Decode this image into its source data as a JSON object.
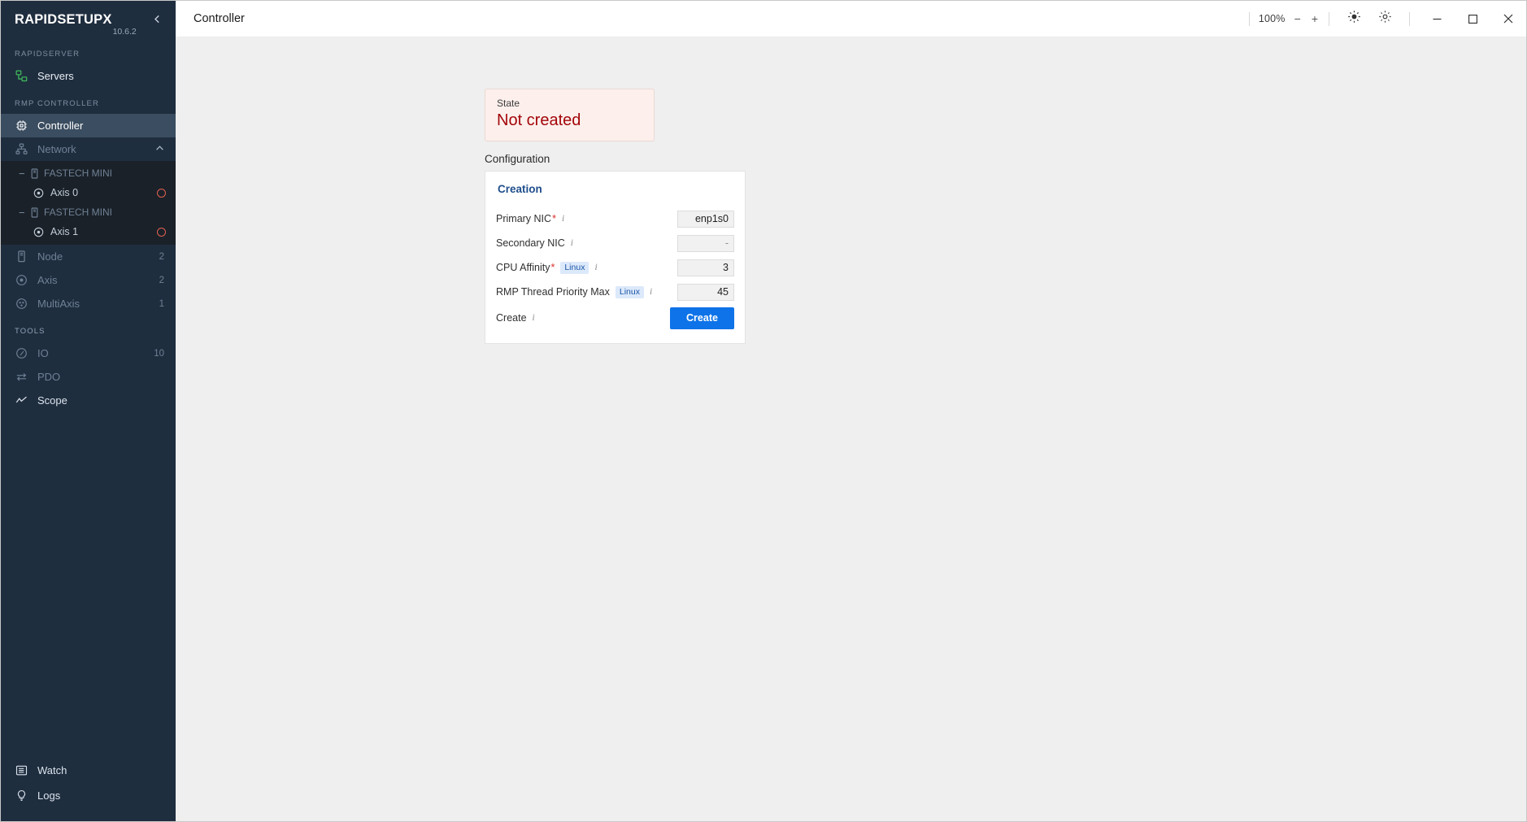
{
  "sidebar": {
    "brand": {
      "name": "RAPIDSETUPX",
      "version": "10.6.2",
      "collapse_icon": "chevron-left-icon"
    },
    "sections": [
      {
        "label": "RAPIDSERVER"
      },
      {
        "label": "RMP CONTROLLER"
      },
      {
        "label": "TOOLS"
      }
    ],
    "servers_item": {
      "label": "Servers",
      "icon": "servers-icon"
    },
    "controller_item": {
      "label": "Controller",
      "icon": "chip-icon"
    },
    "network_item": {
      "label": "Network",
      "icon": "network-icon",
      "chevron": "chevron-up-icon"
    },
    "tree": [
      {
        "label": "FASTECH MINI",
        "icon": "device-icon",
        "expander": "minus-icon"
      },
      {
        "label": "Axis 0",
        "icon": "axis-icon",
        "status": "status-ring-red"
      },
      {
        "label": "FASTECH MINI",
        "icon": "device-icon",
        "expander": "minus-icon"
      },
      {
        "label": "Axis 1",
        "icon": "axis-icon",
        "status": "status-ring-red"
      }
    ],
    "resource_items": [
      {
        "label": "Node",
        "icon": "node-icon",
        "badge": "2"
      },
      {
        "label": "Axis",
        "icon": "axis-icon",
        "badge": "2"
      },
      {
        "label": "MultiAxis",
        "icon": "multiaxis-icon",
        "badge": "1"
      }
    ],
    "tools_items": [
      {
        "label": "IO",
        "icon": "io-icon",
        "badge": "10"
      },
      {
        "label": "PDO",
        "icon": "pdo-icon",
        "badge": ""
      },
      {
        "label": "Scope",
        "icon": "scope-icon",
        "badge": ""
      }
    ],
    "bottom_items": [
      {
        "label": "Watch",
        "icon": "watch-icon"
      },
      {
        "label": "Logs",
        "icon": "bulb-icon"
      }
    ]
  },
  "titlebar": {
    "title": "Controller",
    "zoom": {
      "percent": "100%",
      "minus": "−",
      "plus": "+"
    },
    "theme_icon": "sun-icon",
    "settings_icon": "gear-icon",
    "minimize": "−",
    "maximize": "□",
    "close": "✕"
  },
  "content": {
    "state_card": {
      "label": "State",
      "value": "Not created"
    },
    "config_heading": "Configuration",
    "panel": {
      "title": "Creation",
      "rows": [
        {
          "label": "Primary NIC",
          "required": true,
          "os": "",
          "info": "i",
          "value": "enp1s0",
          "empty": false
        },
        {
          "label": "Secondary NIC",
          "required": false,
          "os": "",
          "info": "i",
          "value": "-",
          "empty": true
        },
        {
          "label": "CPU Affinity",
          "required": true,
          "os": "Linux",
          "info": "i",
          "value": "3",
          "empty": false
        },
        {
          "label": "RMP Thread Priority Max",
          "required": false,
          "os": "Linux",
          "info": "i",
          "value": "45",
          "empty": false
        }
      ],
      "create_row": {
        "label": "Create",
        "info": "i",
        "button": "Create"
      }
    }
  },
  "colors": {
    "sidebar_bg": "#1f2e3f",
    "tree_bg": "#1a2129",
    "accent_blue": "#0e73e8",
    "panel_title": "#1f4e8c",
    "state_red": "#a3050a",
    "state_bg": "#fdf0ec",
    "status_red": "#e2604f",
    "servers_green": "#3fbd5a"
  }
}
